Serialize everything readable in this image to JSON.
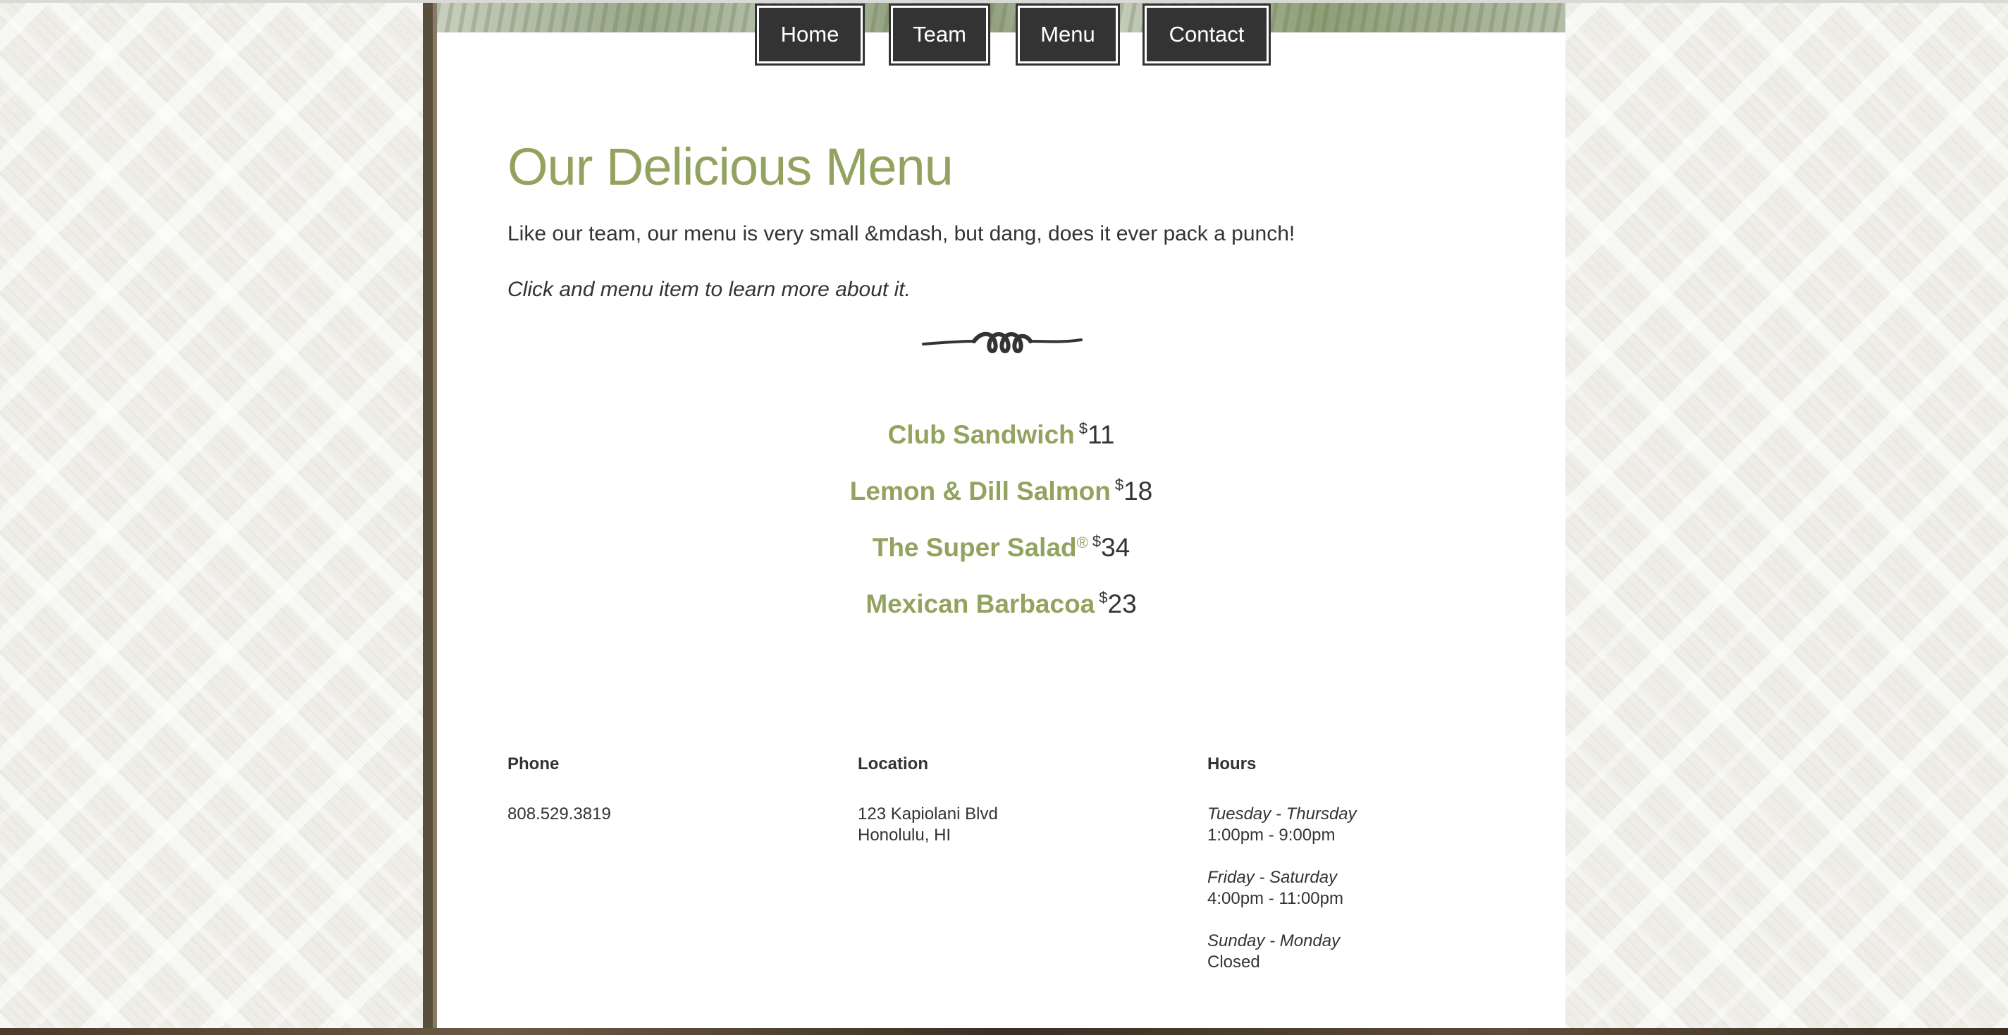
{
  "nav": {
    "home_label": "Home",
    "team_label": "Team",
    "menu_label": "Menu",
    "contact_label": "Contact"
  },
  "main": {
    "title": "Our Delicious Menu",
    "intro": "Like our team, our menu is very small &mdash, but dang, does it ever pack a punch!",
    "hint": "Click and menu item to learn more about it.",
    "currency_symbol": "$",
    "items": [
      {
        "name": "Club Sandwich",
        "price": "11"
      },
      {
        "name": "Lemon & Dill Salmon",
        "price": "18"
      },
      {
        "name": "The Super Salad",
        "mark": "®",
        "price": "34"
      },
      {
        "name": "Mexican Barbacoa",
        "price": "23"
      }
    ]
  },
  "footer": {
    "phone": {
      "heading": "Phone",
      "value": "808.529.3819"
    },
    "location": {
      "heading": "Location",
      "line1": "123 Kapiolani Blvd",
      "line2": "Honolulu, HI"
    },
    "hours": {
      "heading": "Hours",
      "groups": [
        {
          "days": "Tuesday - Thursday",
          "time": "1:00pm - 9:00pm"
        },
        {
          "days": "Friday - Saturday",
          "time": "4:00pm - 11:00pm"
        },
        {
          "days": "Sunday - Monday",
          "time": "Closed"
        }
      ]
    }
  },
  "colors": {
    "accent": "#93a35f",
    "text": "#333333",
    "nav_bg": "#333333"
  }
}
